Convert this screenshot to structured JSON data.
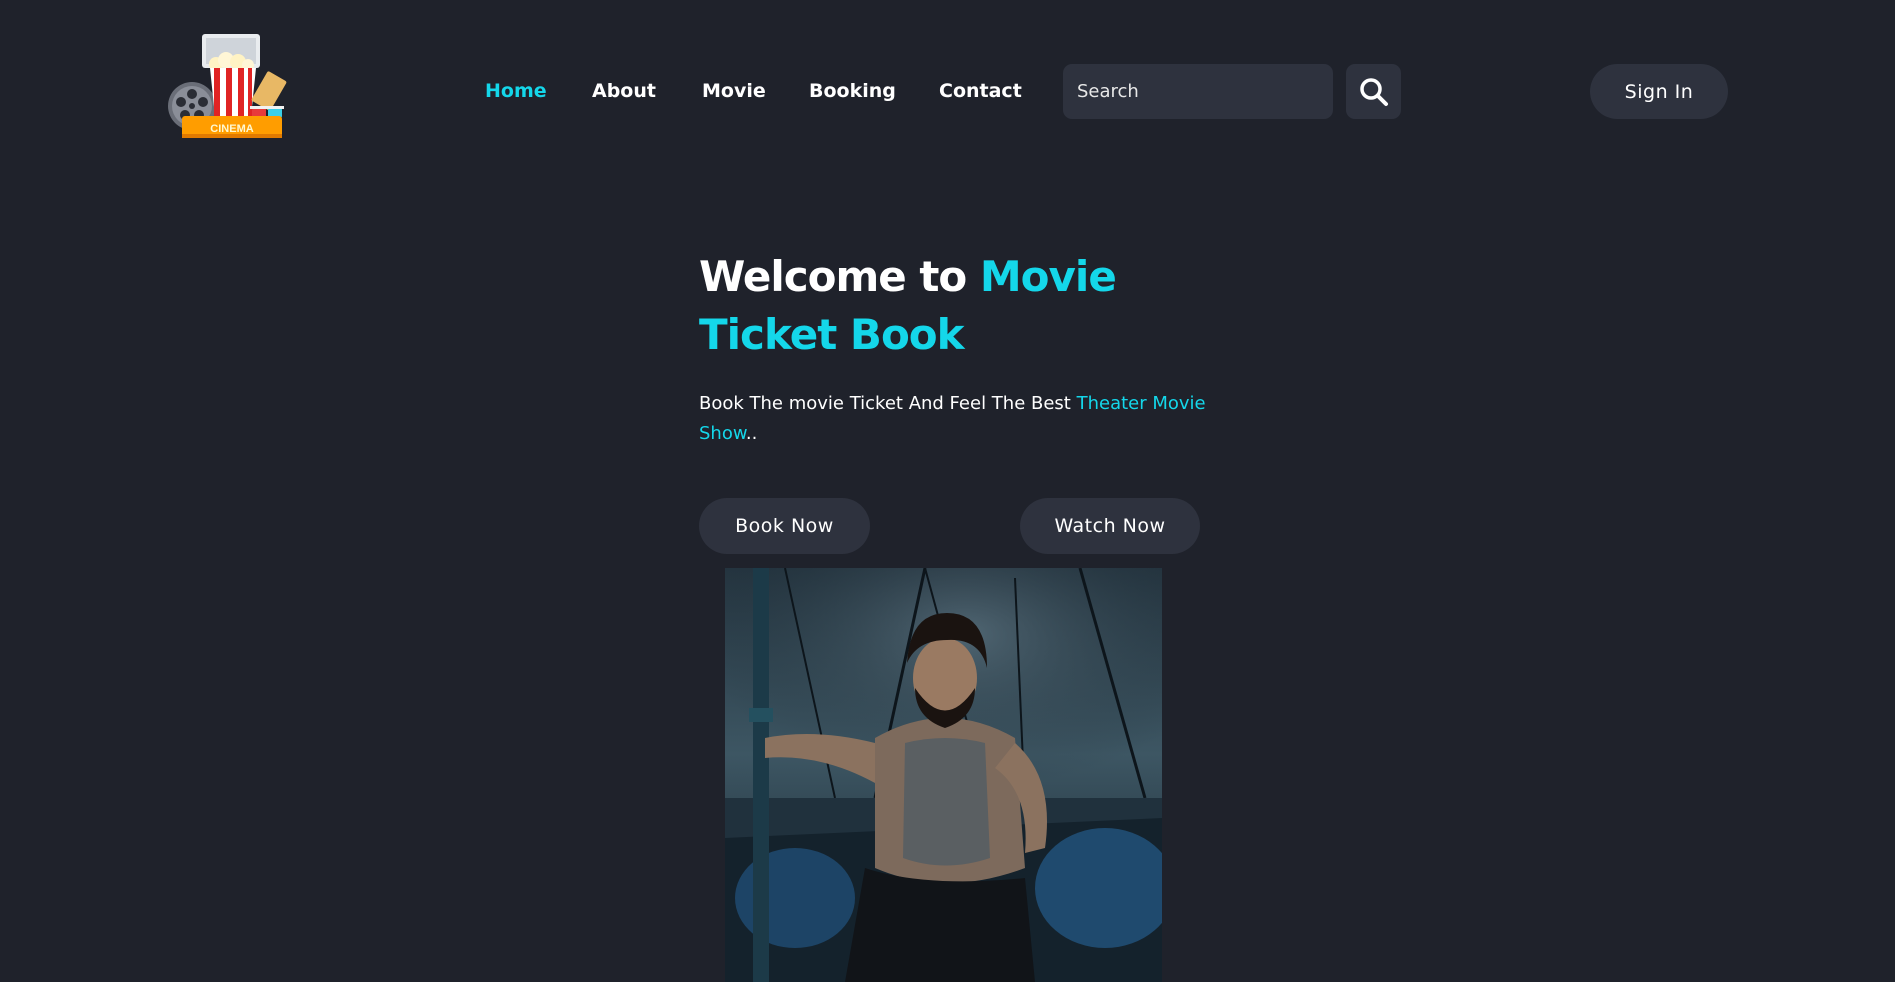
{
  "header": {
    "logo_label": "CINEMA",
    "nav": [
      {
        "label": "Home",
        "active": true
      },
      {
        "label": "About",
        "active": false
      },
      {
        "label": "Movie",
        "active": false
      },
      {
        "label": "Booking",
        "active": false
      },
      {
        "label": "Contact",
        "active": false
      }
    ],
    "search_placeholder": "Search",
    "search_icon": "search-icon",
    "signin_label": "Sign In"
  },
  "hero": {
    "title_part1": "Welcome to",
    "title_accent": "Movie Ticket Book",
    "desc_part1": "Book The movie Ticket And Feel The Best",
    "desc_accent": "Theater Movie Show",
    "desc_end": "..",
    "book_label": "Book Now",
    "watch_label": "Watch Now"
  },
  "colors": {
    "background": "#1f222b",
    "surface": "#2e323e",
    "accent": "#14d7ea",
    "text": "#ffffff"
  }
}
